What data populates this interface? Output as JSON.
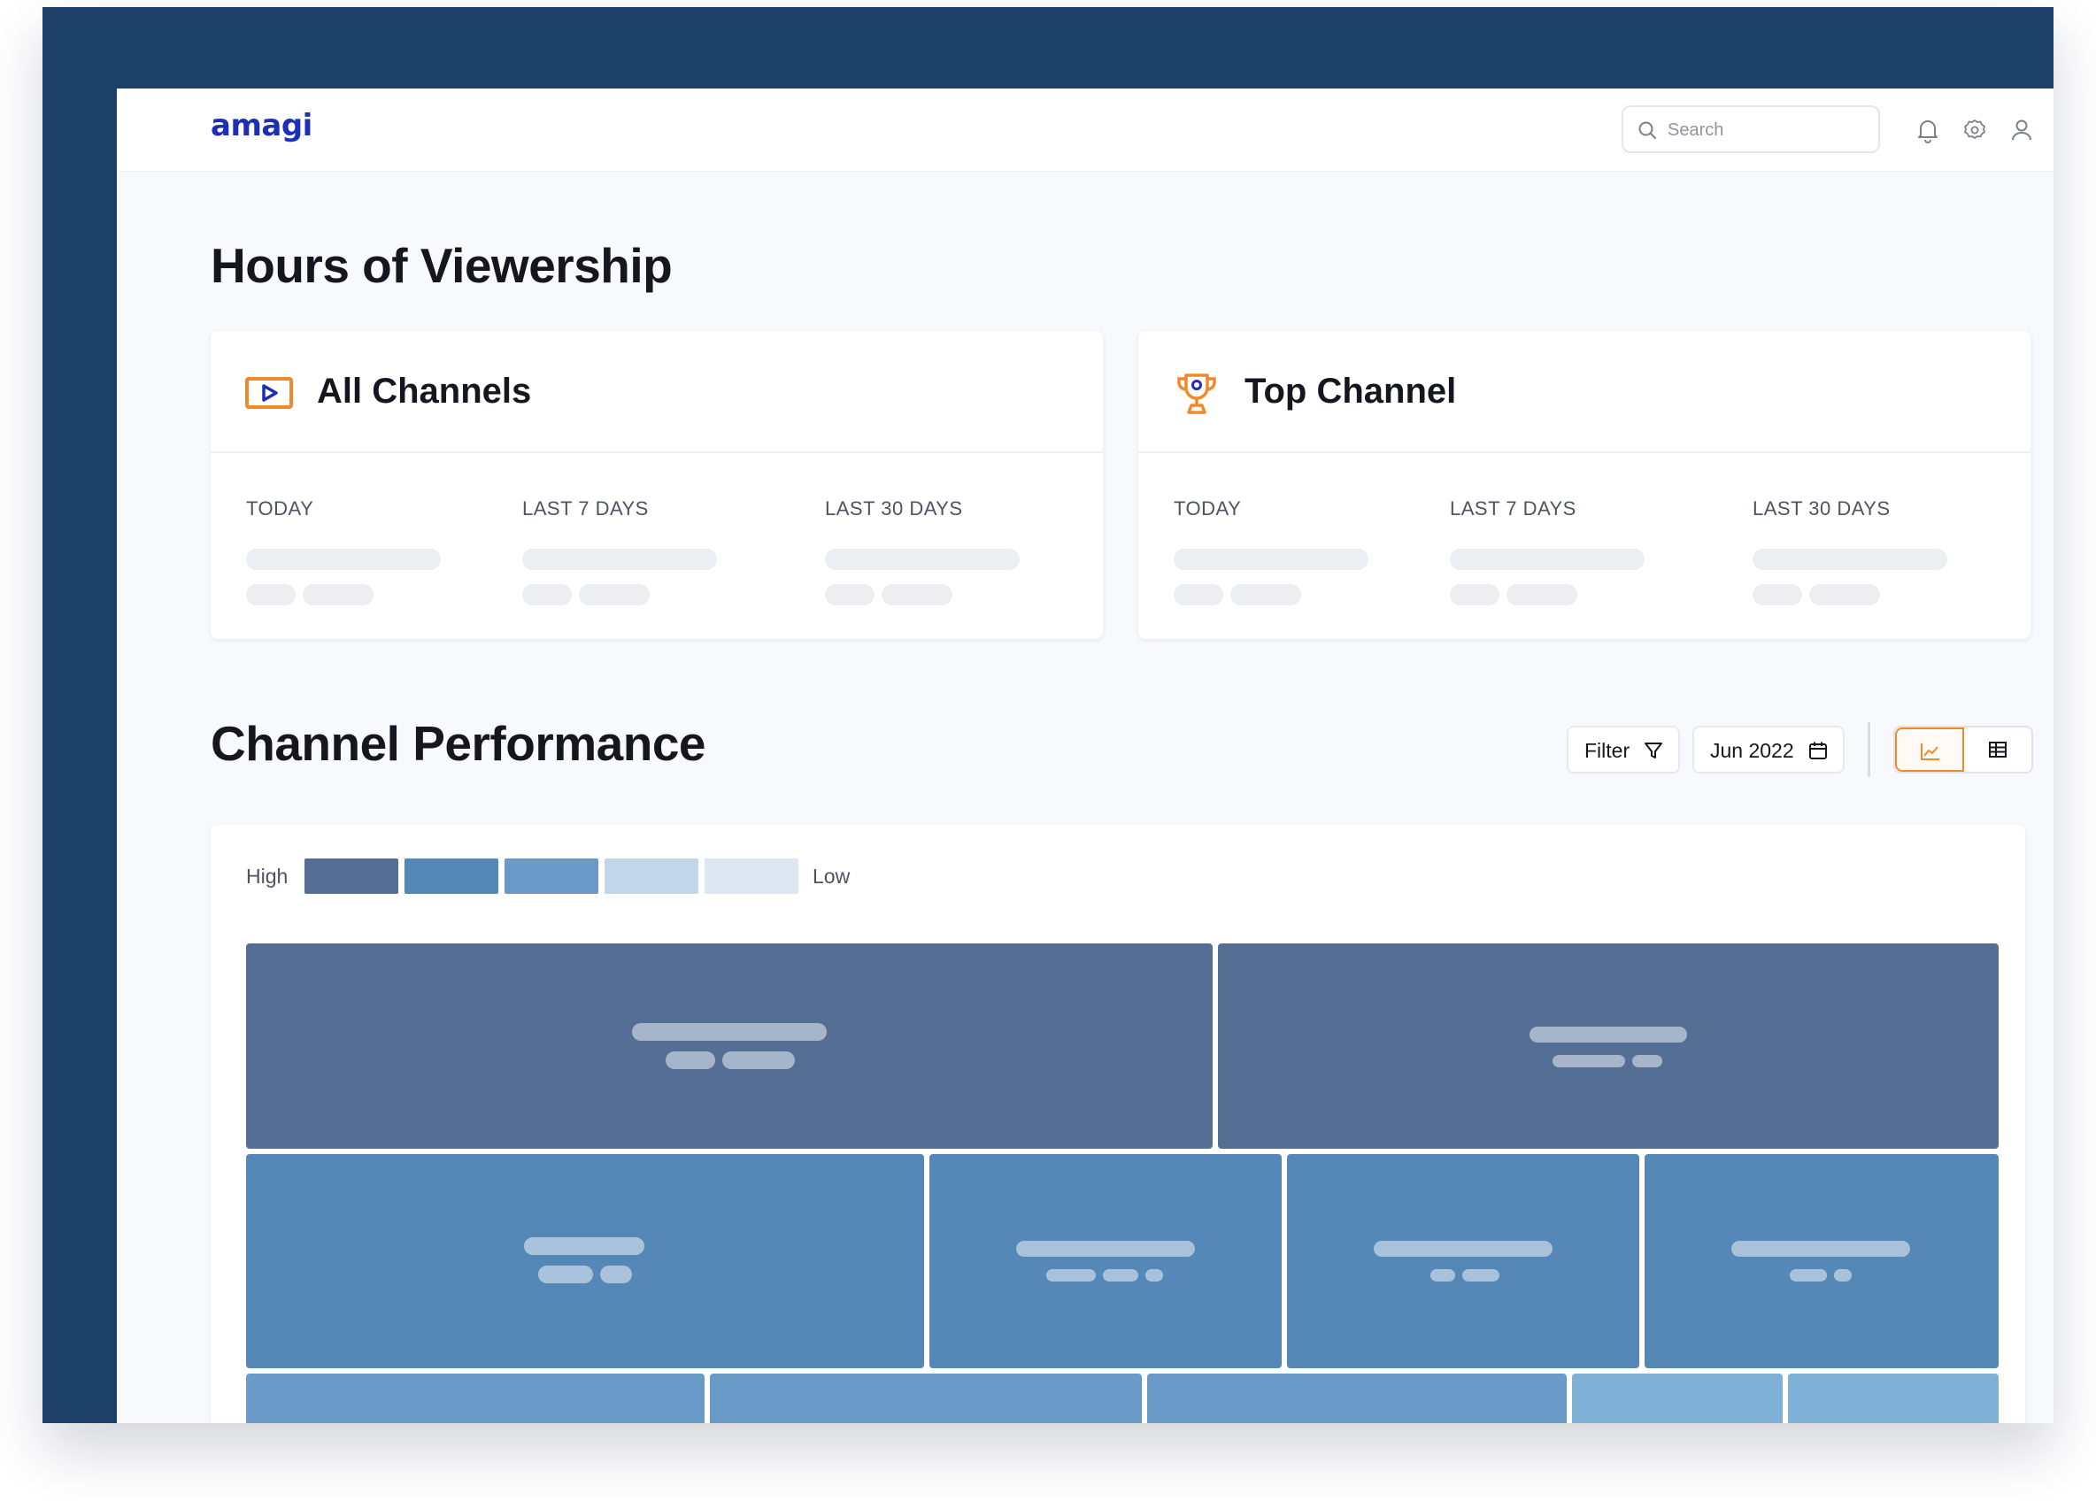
{
  "app": {
    "logo": "amagi",
    "search": {
      "placeholder": "Search",
      "value": ""
    }
  },
  "viewership": {
    "title": "Hours of Viewership",
    "cards": [
      {
        "title": "All Channels",
        "icon": "play-icon",
        "labels": [
          "TODAY",
          "LAST 7 DAYS",
          "LAST 30 DAYS"
        ]
      },
      {
        "title": "Top Channel",
        "icon": "trophy-icon",
        "labels": [
          "TODAY",
          "LAST 7 DAYS",
          "LAST 30 DAYS"
        ]
      }
    ]
  },
  "performance": {
    "title": "Channel Performance",
    "filter_label": "Filter",
    "date_label": "Jun 2022",
    "active_view": "chart",
    "legend": {
      "high": "High",
      "low": "Low",
      "colors": [
        "#546f93",
        "#5587b7",
        "#6a9bc8",
        "#c1d6e8",
        "#dde6f1"
      ]
    }
  },
  "colors": {
    "frame": "#1c4068",
    "accent": "#ef8a2c",
    "brand": "#1d2fb6",
    "tile_level1": "#546f93",
    "tile_level2": "#5587b7",
    "tile_level3": "#6a9bc8",
    "tile_level4": "#7fb0d6"
  }
}
